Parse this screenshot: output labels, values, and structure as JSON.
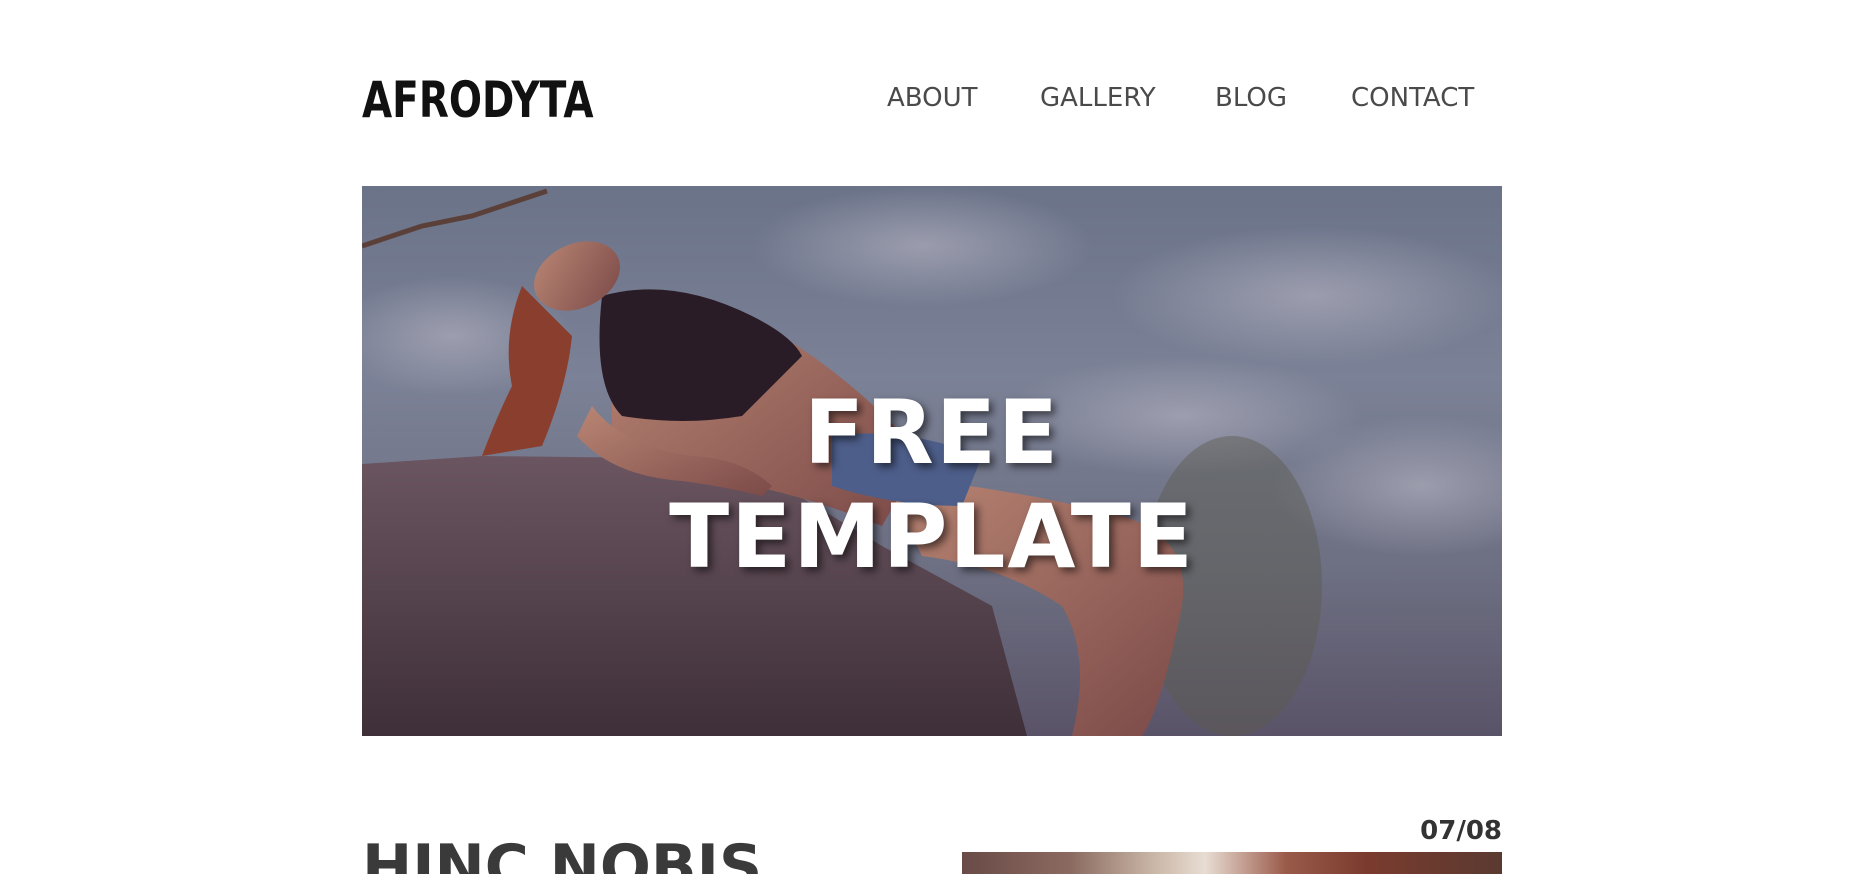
{
  "header": {
    "logo_text": "AFRODYTA",
    "nav": [
      {
        "label": "ABOUT"
      },
      {
        "label": "GALLERY"
      },
      {
        "label": "BLOG"
      },
      {
        "label": "CONTACT"
      }
    ]
  },
  "hero": {
    "title_line1": "FREE",
    "title_line2": "TEMPLATE"
  },
  "post": {
    "date": "07/08",
    "title": "HINC NOBIS"
  },
  "colors": {
    "text_dark": "#111111",
    "nav_text": "#4a4a4a",
    "hero_text": "#ffffff"
  }
}
